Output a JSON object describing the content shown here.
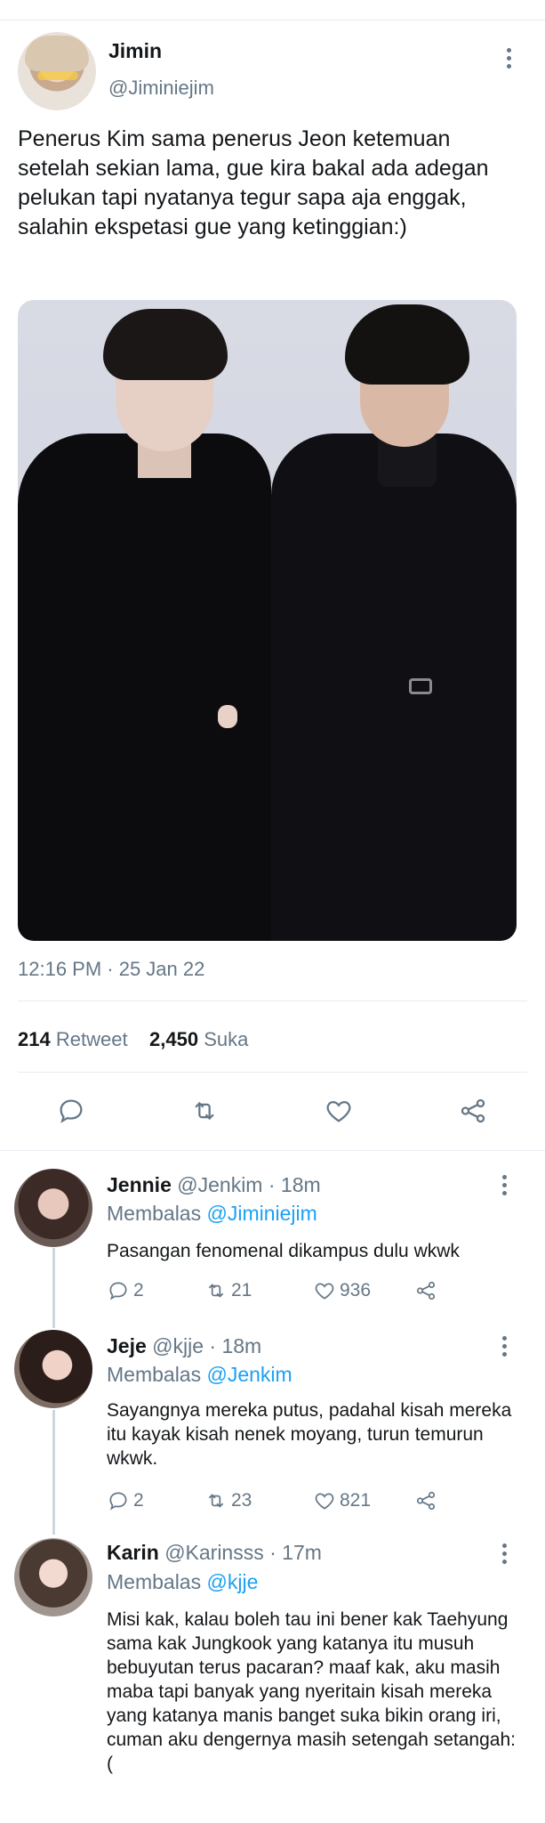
{
  "tweet": {
    "name": "Jimin",
    "handle": "@Jiminiejim",
    "text": "Penerus Kim sama penerus Jeon ketemuan setelah sekian lama, gue kira bakal ada adegan pelukan tapi nyatanya tegur sapa aja enggak, salahin ekspetasi gue yang ketinggian:)",
    "timestamp": "12:16 PM · 25 Jan 22",
    "retweet_count": "214",
    "retweet_label": "Retweet",
    "like_count": "2,450",
    "like_label": "Suka"
  },
  "icons": {
    "menu": "more-vertical-icon",
    "reply": "comment-bubble-icon",
    "retweet": "retweet-arrows-icon",
    "like": "heart-icon",
    "share": "share-nodes-icon"
  },
  "colors": {
    "link": "#1da1f2",
    "secondary": "#657786",
    "divider": "#e6ecf0"
  },
  "replies": [
    {
      "name": "Jennie",
      "handle": "@Jenkim",
      "age": "· 18m",
      "replying_label": "Membalas",
      "replying_to": "@Jiminiejim",
      "text": "Pasangan fenomenal dikampus dulu wkwk",
      "reply_count": "2",
      "retweet_count": "21",
      "like_count": "936"
    },
    {
      "name": "Jeje",
      "handle": "@kjje",
      "age": "· 18m",
      "replying_label": "Membalas",
      "replying_to": "@Jenkim",
      "text": "Sayangnya mereka putus, padahal kisah mereka itu kayak kisah nenek moyang, turun temurun wkwk.",
      "reply_count": "2",
      "retweet_count": "23",
      "like_count": "821"
    },
    {
      "name": "Karin",
      "handle": "@Karinsss",
      "age": "· 17m",
      "replying_label": "Membalas",
      "replying_to": "@kjje",
      "text": "Misi kak, kalau boleh tau ini bener kak Taehyung sama kak Jungkook yang katanya itu musuh bebuyutan terus pacaran? maaf kak, aku masih maba tapi banyak yang nyeritain kisah mereka yang katanya manis banget suka bikin orang iri, cuman aku dengernya masih setengah setangah:("
    }
  ]
}
